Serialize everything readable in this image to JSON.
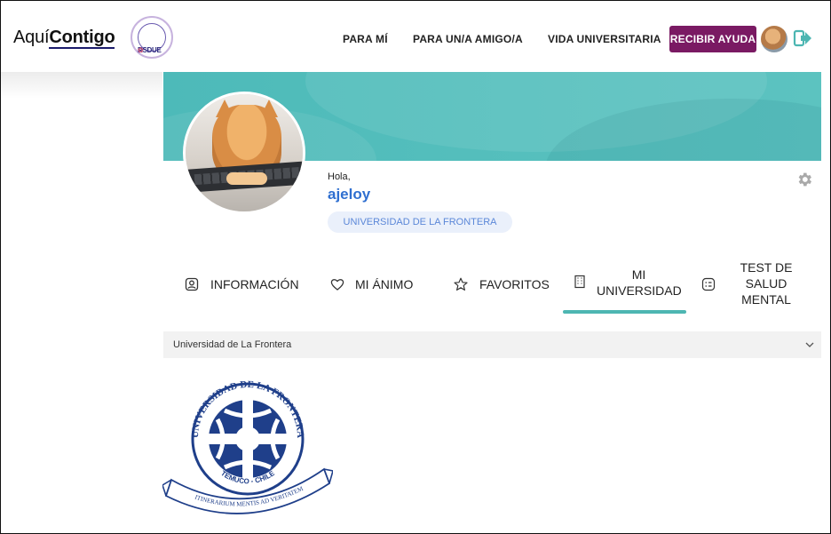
{
  "brand": {
    "logo_prefix": "Aquí",
    "logo_bold": "Contigo",
    "partner_logo_text": "RSDUE"
  },
  "nav": {
    "items": [
      {
        "label": "PARA MÍ"
      },
      {
        "label": "PARA UN/A AMIGO/A"
      },
      {
        "label": "VIDA UNIVERSITARIA"
      }
    ],
    "help_button": "RECIBIR AYUDA"
  },
  "profile": {
    "greeting": "Hola,",
    "username": "ajeloy",
    "university_badge": "UNIVERSIDAD DE LA FRONTERA"
  },
  "tabs": [
    {
      "label": "INFORMACIÓN",
      "icon": "user-icon"
    },
    {
      "label": "MI ÁNIMO",
      "icon": "heart-icon"
    },
    {
      "label": "FAVORITOS",
      "icon": "star-icon"
    },
    {
      "label": "MI UNIVERSIDAD",
      "icon": "building-icon",
      "active": true
    },
    {
      "label": "TEST DE SALUD MENTAL",
      "icon": "checklist-icon"
    }
  ],
  "university_select": {
    "selected": "Universidad de La Frontera"
  },
  "seal": {
    "top_text": "UNIVERSIDAD DE LA FRONTERA",
    "bottom_text": "TEMUCO - CHILE",
    "ribbon_text": "ITINERARIUM MENTIS AD VERITATEM"
  },
  "colors": {
    "accent_teal": "#4db6b2",
    "help_button_bg": "#7a1a63",
    "username_blue": "#2f6fd0",
    "seal_navy": "#1f3f8a"
  }
}
